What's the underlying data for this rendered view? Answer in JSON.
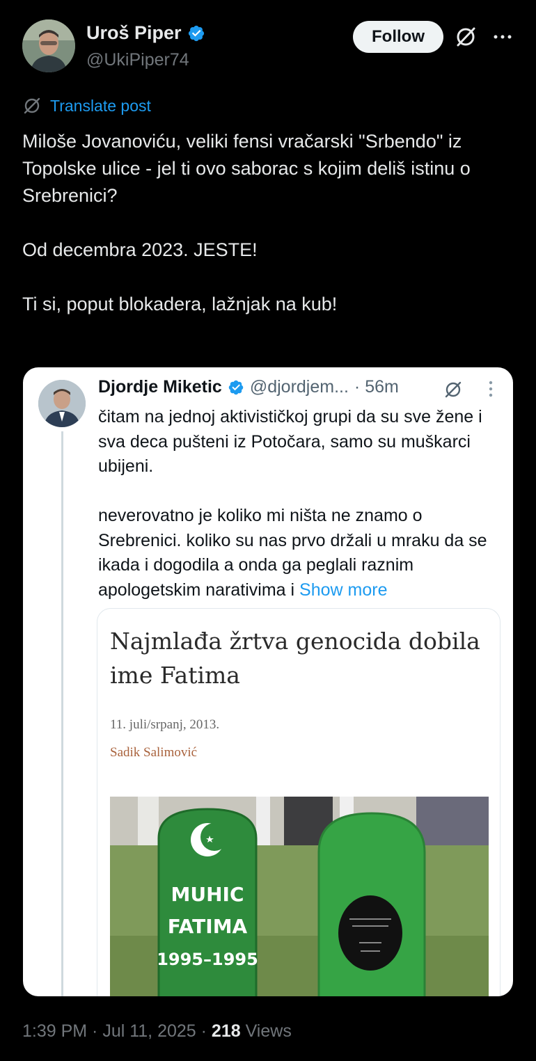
{
  "author": {
    "display_name": "Uroš Piper",
    "handle": "@UkiPiper74",
    "verified": true
  },
  "header": {
    "follow_label": "Follow",
    "grok_icon": "grok-icon",
    "more_icon": "more-icon"
  },
  "translate": {
    "label": "Translate post"
  },
  "post": {
    "lines": [
      "Miloše Jovanoviću, veliki fensi vračarski \"Srbendo\" iz Topolske ulice - jel ti ovo saborac s kojim deliš istinu o Srebrenici?",
      "Od decembra 2023. JESTE!",
      "Ti si, poput blokadera, lažnjak na kub!"
    ]
  },
  "quoted_post": {
    "display_name": "Djordje Miketic",
    "handle": "@djordjem...",
    "time": "· 56m",
    "verified": true,
    "paragraph_1": "čitam na jednoj aktivističkoj grupi da su sve žene i sva deca pušteni iz Potočara, samo su muškarci ubijeni.",
    "paragraph_2": "neverovatno je koliko mi ništa ne znamo o Srebrenici. koliko su nas prvo držali u mraku da se ikada i dogodila a onda ga peglali raznim apologetskim narativima i",
    "show_more": "Show more",
    "article": {
      "title": "Najmlađa žrtva genocida dobila ime Fatima",
      "date": "11. juli/srpanj, 2013.",
      "author": "Sadik Salimović",
      "gravestone_line_1": "MUHIC",
      "gravestone_line_2": "FATIMA",
      "gravestone_line_3": "1995–1995"
    }
  },
  "footer": {
    "time": "1:39 PM",
    "sep1": " · ",
    "date": "Jul 11, 2025",
    "sep2": " · ",
    "views_count": "218",
    "views_label": " Views"
  },
  "colors": {
    "background": "#000000",
    "accent": "#1d9bf0",
    "text": "#e7e9ea",
    "muted": "#71767b",
    "gravestone_green": "#2e8b3c"
  }
}
